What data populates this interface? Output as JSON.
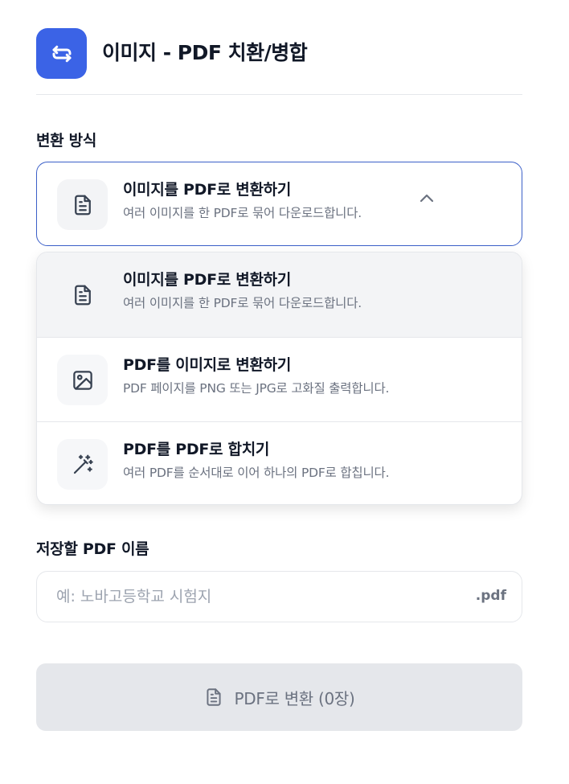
{
  "app": {
    "title": "이미지 - PDF 치환/병합",
    "icon": "repeat-icon",
    "accent": "#3b63e6"
  },
  "mode": {
    "label": "변환 방식",
    "selected": {
      "title": "이미지를 PDF로 변환하기",
      "desc": "여러 이미지를 한 PDF로 묶어 다운로드합니다.",
      "icon": "file-text-icon"
    },
    "options": [
      {
        "title": "이미지를 PDF로 변환하기",
        "desc": "여러 이미지를 한 PDF로 묶어 다운로드합니다.",
        "icon": "file-text-icon",
        "active": true
      },
      {
        "title": "PDF를 이미지로 변환하기",
        "desc": "PDF 페이지를 PNG 또는 JPG로 고화질 출력합니다.",
        "icon": "image-icon",
        "active": false
      },
      {
        "title": "PDF를 PDF로 합치기",
        "desc": "여러 PDF를 순서대로 이어 하나의 PDF로 합칩니다.",
        "icon": "magic-wand-icon",
        "active": false
      }
    ]
  },
  "filename": {
    "label": "저장할 PDF 이름",
    "placeholder": "예: 노바고등학교 시험지",
    "value": "",
    "suffix": ".pdf"
  },
  "convert": {
    "label": "PDF로 변환 (0장)",
    "icon": "file-text-icon",
    "disabled": true
  }
}
